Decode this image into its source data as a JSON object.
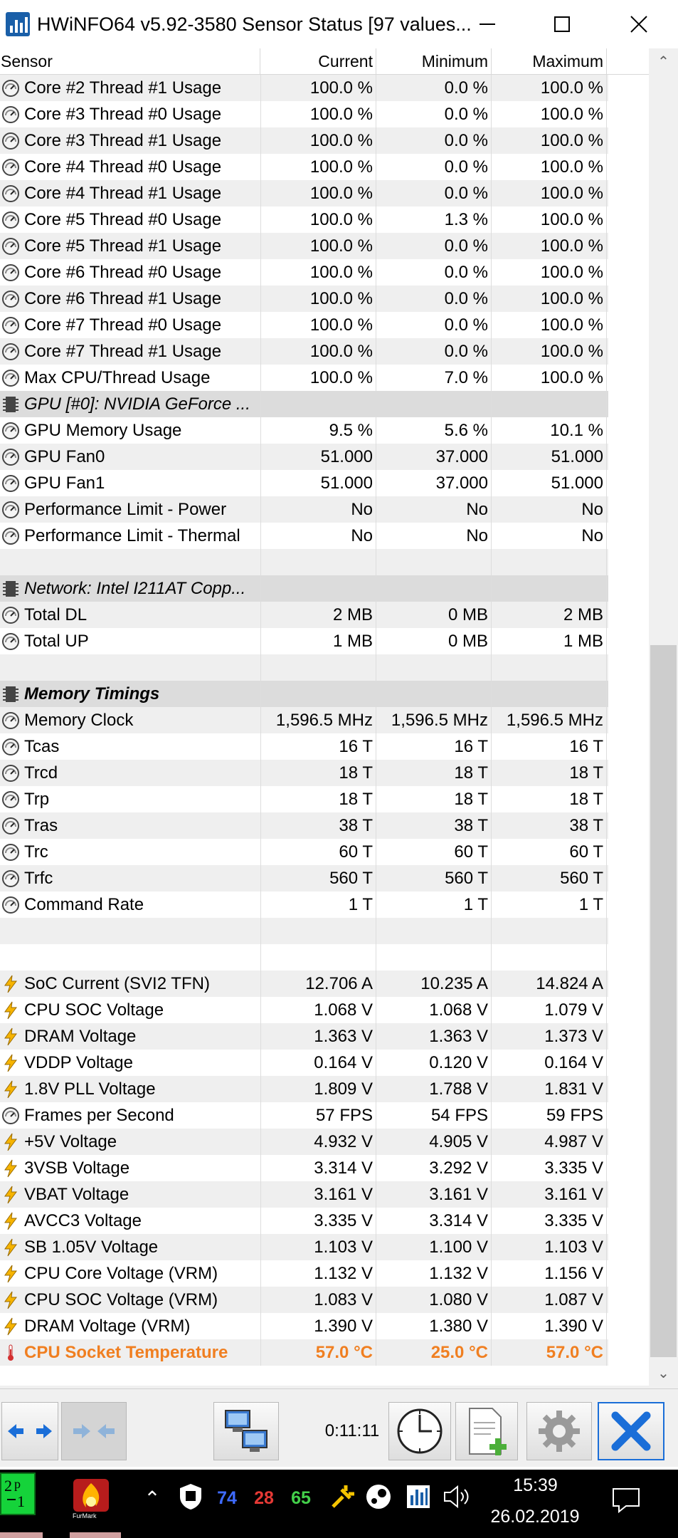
{
  "window": {
    "title": "HWiNFO64 v5.92-3580 Sensor Status [97 values..."
  },
  "columns": {
    "sensor": "Sensor",
    "current": "Current",
    "minimum": "Minimum",
    "maximum": "Maximum"
  },
  "rows": [
    {
      "type": "sensor",
      "icon": "gauge-icon",
      "label": "Core #2 Thread #1 Usage",
      "current": "100.0 %",
      "min": "0.0 %",
      "max": "100.0 %"
    },
    {
      "type": "sensor",
      "icon": "gauge-icon",
      "label": "Core #3 Thread #0 Usage",
      "current": "100.0 %",
      "min": "0.0 %",
      "max": "100.0 %"
    },
    {
      "type": "sensor",
      "icon": "gauge-icon",
      "label": "Core #3 Thread #1 Usage",
      "current": "100.0 %",
      "min": "0.0 %",
      "max": "100.0 %"
    },
    {
      "type": "sensor",
      "icon": "gauge-icon",
      "label": "Core #4 Thread #0 Usage",
      "current": "100.0 %",
      "min": "0.0 %",
      "max": "100.0 %"
    },
    {
      "type": "sensor",
      "icon": "gauge-icon",
      "label": "Core #4 Thread #1 Usage",
      "current": "100.0 %",
      "min": "0.0 %",
      "max": "100.0 %"
    },
    {
      "type": "sensor",
      "icon": "gauge-icon",
      "label": "Core #5 Thread #0 Usage",
      "current": "100.0 %",
      "min": "1.3 %",
      "max": "100.0 %"
    },
    {
      "type": "sensor",
      "icon": "gauge-icon",
      "label": "Core #5 Thread #1 Usage",
      "current": "100.0 %",
      "min": "0.0 %",
      "max": "100.0 %"
    },
    {
      "type": "sensor",
      "icon": "gauge-icon",
      "label": "Core #6 Thread #0 Usage",
      "current": "100.0 %",
      "min": "0.0 %",
      "max": "100.0 %"
    },
    {
      "type": "sensor",
      "icon": "gauge-icon",
      "label": "Core #6 Thread #1 Usage",
      "current": "100.0 %",
      "min": "0.0 %",
      "max": "100.0 %"
    },
    {
      "type": "sensor",
      "icon": "gauge-icon",
      "label": "Core #7 Thread #0 Usage",
      "current": "100.0 %",
      "min": "0.0 %",
      "max": "100.0 %"
    },
    {
      "type": "sensor",
      "icon": "gauge-icon",
      "label": "Core #7 Thread #1 Usage",
      "current": "100.0 %",
      "min": "0.0 %",
      "max": "100.0 %"
    },
    {
      "type": "sensor",
      "icon": "gauge-icon",
      "label": "Max CPU/Thread Usage",
      "current": "100.0 %",
      "min": "7.0 %",
      "max": "100.0 %"
    },
    {
      "type": "group",
      "icon": "chip-icon",
      "label": "GPU [#0]: NVIDIA GeForce ..."
    },
    {
      "type": "sensor",
      "icon": "gauge-icon",
      "label": "GPU Memory Usage",
      "current": "9.5 %",
      "min": "5.6 %",
      "max": "10.1 %"
    },
    {
      "type": "sensor",
      "icon": "gauge-icon",
      "label": "GPU Fan0",
      "current": "51.000",
      "min": "37.000",
      "max": "51.000"
    },
    {
      "type": "sensor",
      "icon": "gauge-icon",
      "label": "GPU Fan1",
      "current": "51.000",
      "min": "37.000",
      "max": "51.000"
    },
    {
      "type": "sensor",
      "icon": "gauge-icon",
      "label": "Performance Limit - Power",
      "current": "No",
      "min": "No",
      "max": "No"
    },
    {
      "type": "sensor",
      "icon": "gauge-icon",
      "label": "Performance Limit - Thermal",
      "current": "No",
      "min": "No",
      "max": "No"
    },
    {
      "type": "blank"
    },
    {
      "type": "group",
      "icon": "chip-icon",
      "label": "Network: Intel I211AT Copp..."
    },
    {
      "type": "sensor",
      "icon": "gauge-icon",
      "label": "Total DL",
      "current": "2 MB",
      "min": "0 MB",
      "max": "2 MB"
    },
    {
      "type": "sensor",
      "icon": "gauge-icon",
      "label": "Total UP",
      "current": "1 MB",
      "min": "0 MB",
      "max": "1 MB"
    },
    {
      "type": "blank"
    },
    {
      "type": "group-bold",
      "icon": "chip-icon",
      "label": "Memory Timings"
    },
    {
      "type": "sensor",
      "icon": "gauge-icon",
      "label": "Memory Clock",
      "current": "1,596.5 MHz",
      "min": "1,596.5 MHz",
      "max": "1,596.5 MHz"
    },
    {
      "type": "sensor",
      "icon": "gauge-icon",
      "label": "Tcas",
      "current": "16 T",
      "min": "16 T",
      "max": "16 T"
    },
    {
      "type": "sensor",
      "icon": "gauge-icon",
      "label": "Trcd",
      "current": "18 T",
      "min": "18 T",
      "max": "18 T"
    },
    {
      "type": "sensor",
      "icon": "gauge-icon",
      "label": "Trp",
      "current": "18 T",
      "min": "18 T",
      "max": "18 T"
    },
    {
      "type": "sensor",
      "icon": "gauge-icon",
      "label": "Tras",
      "current": "38 T",
      "min": "38 T",
      "max": "38 T"
    },
    {
      "type": "sensor",
      "icon": "gauge-icon",
      "label": "Trc",
      "current": "60 T",
      "min": "60 T",
      "max": "60 T"
    },
    {
      "type": "sensor",
      "icon": "gauge-icon",
      "label": "Trfc",
      "current": "560 T",
      "min": "560 T",
      "max": "560 T"
    },
    {
      "type": "sensor",
      "icon": "gauge-icon",
      "label": "Command Rate",
      "current": "1 T",
      "min": "1 T",
      "max": "1 T"
    },
    {
      "type": "blank"
    },
    {
      "type": "blank"
    },
    {
      "type": "sensor",
      "icon": "lightning-icon",
      "label": "SoC Current (SVI2 TFN)",
      "current": "12.706 A",
      "min": "10.235 A",
      "max": "14.824 A"
    },
    {
      "type": "sensor",
      "icon": "lightning-icon",
      "label": "CPU SOC Voltage",
      "current": "1.068 V",
      "min": "1.068 V",
      "max": "1.079 V"
    },
    {
      "type": "sensor",
      "icon": "lightning-icon",
      "label": "DRAM Voltage",
      "current": "1.363 V",
      "min": "1.363 V",
      "max": "1.373 V"
    },
    {
      "type": "sensor",
      "icon": "lightning-icon",
      "label": "VDDP Voltage",
      "current": "0.164 V",
      "min": "0.120 V",
      "max": "0.164 V"
    },
    {
      "type": "sensor",
      "icon": "lightning-icon",
      "label": "1.8V PLL Voltage",
      "current": "1.809 V",
      "min": "1.788 V",
      "max": "1.831 V"
    },
    {
      "type": "sensor",
      "icon": "gauge-icon",
      "label": "Frames per Second",
      "current": "57 FPS",
      "min": "54 FPS",
      "max": "59 FPS"
    },
    {
      "type": "sensor",
      "icon": "lightning-icon",
      "label": "+5V Voltage",
      "current": "4.932 V",
      "min": "4.905 V",
      "max": "4.987 V"
    },
    {
      "type": "sensor",
      "icon": "lightning-icon",
      "label": "3VSB Voltage",
      "current": "3.314 V",
      "min": "3.292 V",
      "max": "3.335 V"
    },
    {
      "type": "sensor",
      "icon": "lightning-icon",
      "label": "VBAT Voltage",
      "current": "3.161 V",
      "min": "3.161 V",
      "max": "3.161 V"
    },
    {
      "type": "sensor",
      "icon": "lightning-icon",
      "label": "AVCC3 Voltage",
      "current": "3.335 V",
      "min": "3.314 V",
      "max": "3.335 V"
    },
    {
      "type": "sensor",
      "icon": "lightning-icon",
      "label": "SB 1.05V Voltage",
      "current": "1.103 V",
      "min": "1.100 V",
      "max": "1.103 V"
    },
    {
      "type": "sensor",
      "icon": "lightning-icon",
      "label": "CPU Core Voltage (VRM)",
      "current": "1.132 V",
      "min": "1.132 V",
      "max": "1.156 V"
    },
    {
      "type": "sensor",
      "icon": "lightning-icon",
      "label": "CPU SOC Voltage (VRM)",
      "current": "1.083 V",
      "min": "1.080 V",
      "max": "1.087 V"
    },
    {
      "type": "sensor",
      "icon": "lightning-icon",
      "label": "DRAM Voltage (VRM)",
      "current": "1.390 V",
      "min": "1.380 V",
      "max": "1.390 V"
    },
    {
      "type": "sensor-hot",
      "icon": "thermometer-icon",
      "label": "CPU Socket Temperature",
      "current": "57.0 °C",
      "min": "25.0 °C",
      "max": "57.0 °C"
    }
  ],
  "toolbar": {
    "elapsed": "0:11:11"
  },
  "taskbar": {
    "time": "15:39",
    "date": "26.02.2019",
    "tray_values": [
      "74",
      "28",
      "65"
    ],
    "furmark_label": "FurMark"
  },
  "colors": {
    "highlight": "#f07f21",
    "group_bg": "#dcdcdc",
    "alt_row": "#efefef",
    "close_blue": "#1a6ed8"
  }
}
